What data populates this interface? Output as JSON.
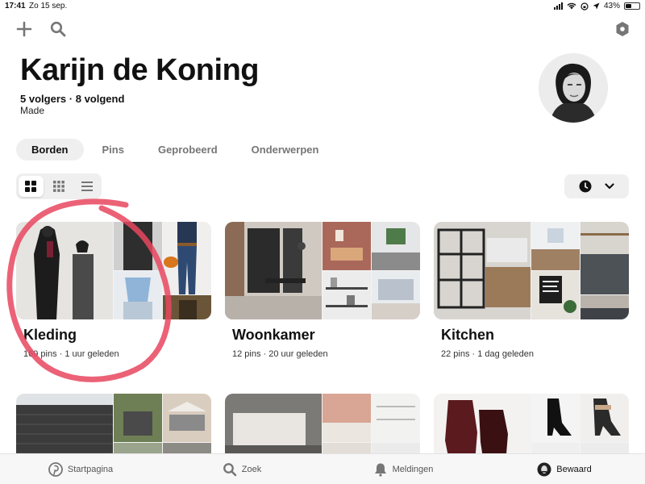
{
  "status_bar": {
    "time": "17:41",
    "date": "Zo 15 sep.",
    "battery": "43%",
    "battery_level": 0.43
  },
  "toolbar": {
    "add_icon": "plus-icon",
    "search_icon": "search-icon",
    "settings_icon": "hexagon-settings-icon"
  },
  "profile": {
    "name": "Karijn de Koning",
    "followers_count": "5",
    "followers_label": "volgers",
    "separator": "·",
    "following_count": "8",
    "following_label": "volgend",
    "subtitle": "Made"
  },
  "tabs": [
    {
      "label": "Borden",
      "active": true
    },
    {
      "label": "Pins",
      "active": false
    },
    {
      "label": "Geprobeerd",
      "active": false
    },
    {
      "label": "Onderwerpen",
      "active": false
    }
  ],
  "view_options": {
    "active": "grid-large",
    "options": [
      "grid-large-icon",
      "grid-small-icon",
      "list-icon"
    ]
  },
  "sort": {
    "icon": "clock-icon",
    "caret": "chevron-down-icon"
  },
  "boards": [
    {
      "title": "Kleding",
      "meta": "169 pins · 1 uur geleden"
    },
    {
      "title": "Woonkamer",
      "meta": "12 pins · 20 uur geleden"
    },
    {
      "title": "Kitchen",
      "meta": "22 pins · 1 dag geleden"
    },
    {
      "title": "",
      "meta": ""
    },
    {
      "title": "",
      "meta": ""
    },
    {
      "title": "",
      "meta": ""
    }
  ],
  "bottom_nav": [
    {
      "label": "Startpagina",
      "icon": "pinterest-icon",
      "active": false
    },
    {
      "label": "Zoek",
      "icon": "search-icon",
      "active": false
    },
    {
      "label": "Meldingen",
      "icon": "bell-icon",
      "active": false
    },
    {
      "label": "Bewaard",
      "icon": "avatar-icon",
      "active": true
    }
  ],
  "colors": {
    "accent_annotation": "#e8475f",
    "tab_active_bg": "#efefef",
    "text_primary": "#111111"
  }
}
